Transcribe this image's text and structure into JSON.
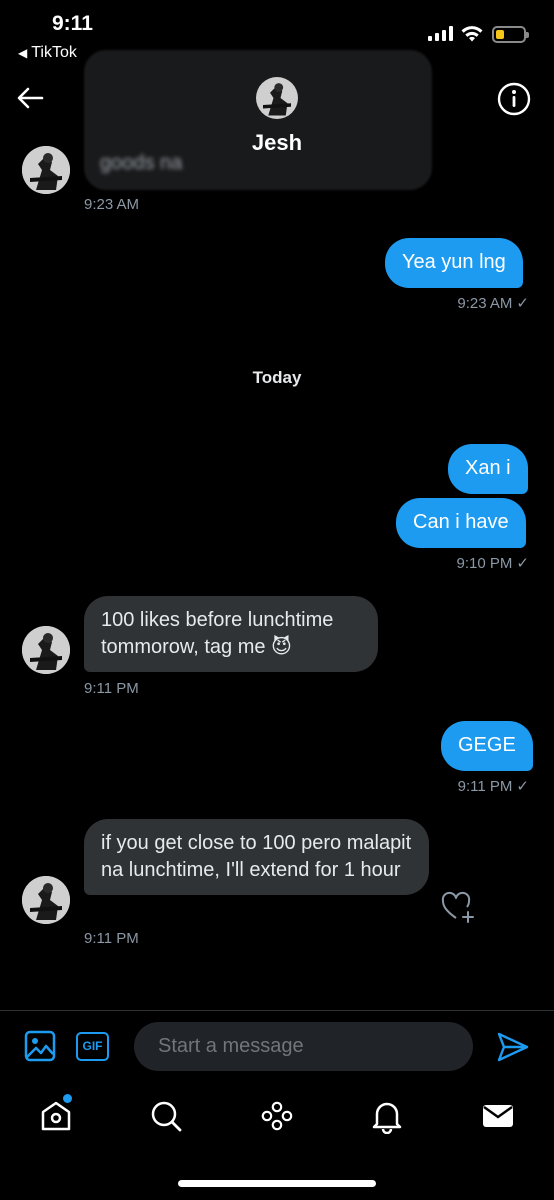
{
  "status_bar": {
    "time": "9:11",
    "back_app": "TikTok",
    "back_glyph": "◀"
  },
  "header": {
    "name": "Jesh",
    "blurred_text": "goods na"
  },
  "messages": {
    "m0_time": "9:23 AM",
    "m1_text": "Yea yun lng",
    "m1_time": "9:23 AM",
    "day_separator": "Today",
    "m2_text": "Xan i",
    "m3_text": "Can i have",
    "m3_time": "9:10 PM",
    "m4_text": "100 likes before lunchtime tommorow, tag me 😈",
    "m4_time": "9:11 PM",
    "m5_text": "GEGE",
    "m5_time": "9:11 PM",
    "m6_text": "if you get close to 100 pero malapit na lunchtime, I'll extend for 1 hour",
    "m6_time": "9:11 PM",
    "read_check": "✓"
  },
  "composer": {
    "placeholder": "Start a message",
    "gif_label": "GIF"
  },
  "tabs": [
    "home-icon",
    "search-icon",
    "spaces-icon",
    "notifications-icon",
    "messages-icon"
  ],
  "colors": {
    "accent": "#1d9bf0",
    "incoming_bubble": "#2f3336",
    "background": "#000000",
    "notification_dot": "#1d9bf0"
  }
}
